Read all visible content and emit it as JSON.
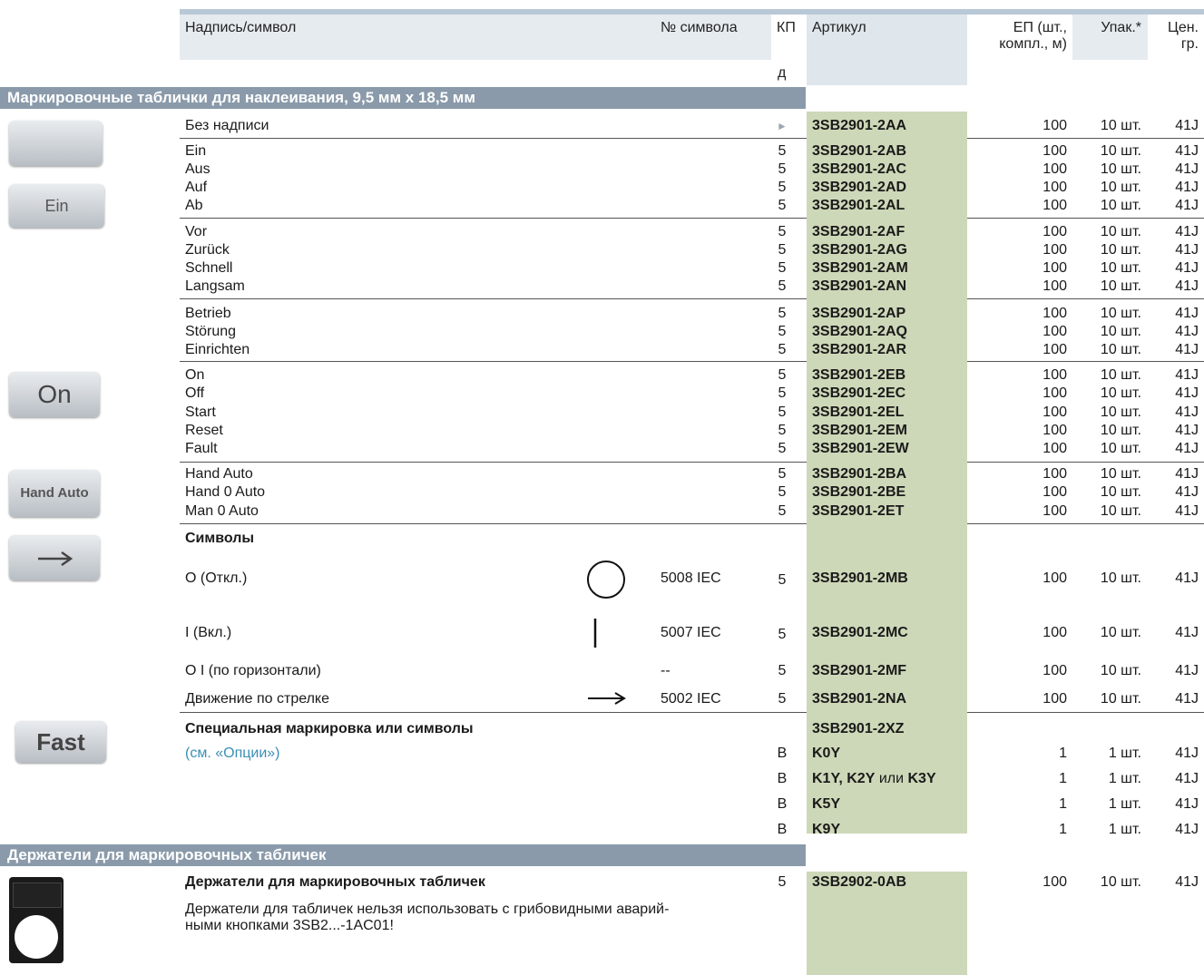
{
  "header": {
    "col_label": "Надпись/символ",
    "col_symbol": "№ символа",
    "col_kp": "КП",
    "col_kp2": "д",
    "col_article": "Артикул",
    "col_ep1": "ЕП (шт.,",
    "col_ep2": "компл., м)",
    "col_pack": "Упак.*",
    "col_price1": "Цен.",
    "col_price2": "гр."
  },
  "sections": {
    "labels_title": "Маркировочные таблички для наклеивания, 9,5 мм х 18,5 мм",
    "holders_title": "Держатели для маркировочных табличек"
  },
  "images": {
    "ein": "Ein",
    "on": "On",
    "hand_auto": "Hand Auto",
    "fast": "Fast"
  },
  "rows": [
    {
      "label": "Без надписи",
      "kp": "►",
      "art": "3SB2901-2AA",
      "ep": "100",
      "up": "10 шт.",
      "pr": "41J"
    },
    {
      "label": "Ein",
      "kp": "5",
      "art": "3SB2901-2AB",
      "ep": "100",
      "up": "10 шт.",
      "pr": "41J"
    },
    {
      "label": "Aus",
      "kp": "5",
      "art": "3SB2901-2AC",
      "ep": "100",
      "up": "10 шт.",
      "pr": "41J"
    },
    {
      "label": "Auf",
      "kp": "5",
      "art": "3SB2901-2AD",
      "ep": "100",
      "up": "10 шт.",
      "pr": "41J"
    },
    {
      "label": "Ab",
      "kp": "5",
      "art": "3SB2901-2AL",
      "ep": "100",
      "up": "10 шт.",
      "pr": "41J"
    },
    {
      "label": "Vor",
      "kp": "5",
      "art": "3SB2901-2AF",
      "ep": "100",
      "up": "10 шт.",
      "pr": "41J"
    },
    {
      "label": "Zurück",
      "kp": "5",
      "art": "3SB2901-2AG",
      "ep": "100",
      "up": "10 шт.",
      "pr": "41J"
    },
    {
      "label": "Schnell",
      "kp": "5",
      "art": "3SB2901-2AM",
      "ep": "100",
      "up": "10 шт.",
      "pr": "41J"
    },
    {
      "label": "Langsam",
      "kp": "5",
      "art": "3SB2901-2AN",
      "ep": "100",
      "up": "10 шт.",
      "pr": "41J"
    },
    {
      "label": "Betrieb",
      "kp": "5",
      "art": "3SB2901-2AP",
      "ep": "100",
      "up": "10 шт.",
      "pr": "41J"
    },
    {
      "label": "Störung",
      "kp": "5",
      "art": "3SB2901-2AQ",
      "ep": "100",
      "up": "10 шт.",
      "pr": "41J"
    },
    {
      "label": "Einrichten",
      "kp": "5",
      "art": "3SB2901-2AR",
      "ep": "100",
      "up": "10 шт.",
      "pr": "41J"
    },
    {
      "label": "On",
      "kp": "5",
      "art": "3SB2901-2EB",
      "ep": "100",
      "up": "10 шт.",
      "pr": "41J"
    },
    {
      "label": "Off",
      "kp": "5",
      "art": "3SB2901-2EC",
      "ep": "100",
      "up": "10 шт.",
      "pr": "41J"
    },
    {
      "label": "Start",
      "kp": "5",
      "art": "3SB2901-2EL",
      "ep": "100",
      "up": "10 шт.",
      "pr": "41J"
    },
    {
      "label": "Reset",
      "kp": "5",
      "art": "3SB2901-2EM",
      "ep": "100",
      "up": "10 шт.",
      "pr": "41J"
    },
    {
      "label": "Fault",
      "kp": "5",
      "art": "3SB2901-2EW",
      "ep": "100",
      "up": "10 шт.",
      "pr": "41J"
    },
    {
      "label": "Hand Auto",
      "kp": "5",
      "art": "3SB2901-2BA",
      "ep": "100",
      "up": "10 шт.",
      "pr": "41J"
    },
    {
      "label": "Hand 0 Auto",
      "kp": "5",
      "art": "3SB2901-2BE",
      "ep": "100",
      "up": "10 шт.",
      "pr": "41J"
    },
    {
      "label": "Man 0 Auto",
      "kp": "5",
      "art": "3SB2901-2ET",
      "ep": "100",
      "up": "10 шт.",
      "pr": "41J"
    }
  ],
  "symbols": {
    "title": "Символы",
    "items": [
      {
        "label": "O (Откл.)",
        "sym": "5008 IEC",
        "kp": "5",
        "art": "3SB2901-2MB",
        "ep": "100",
        "up": "10 шт.",
        "pr": "41J"
      },
      {
        "label": "I (Вкл.)",
        "sym": "5007 IEC",
        "kp": "5",
        "art": "3SB2901-2MC",
        "ep": "100",
        "up": "10 шт.",
        "pr": "41J"
      },
      {
        "label": "O  I (по горизонтали)",
        "sym": "--",
        "kp": "5",
        "art": "3SB2901-2MF",
        "ep": "100",
        "up": "10 шт.",
        "pr": "41J"
      },
      {
        "label": "Движение по стрелке",
        "sym": "5002 IEC",
        "kp": "5",
        "art": "3SB2901-2NA",
        "ep": "100",
        "up": "10 шт.",
        "pr": "41J"
      }
    ]
  },
  "special": {
    "title": "Специальная маркировка или символы",
    "title_art": "3SB2901-2XZ",
    "link": "(см. «Опции»)",
    "items": [
      {
        "kp": "B",
        "art": "K0Y",
        "ep": "1",
        "up": "1 шт.",
        "pr": "41J"
      },
      {
        "kp": "B",
        "art_a": "K1Y, K2Y",
        "art_or": " или ",
        "art_b": "K3Y",
        "ep": "1",
        "up": "1 шт.",
        "pr": "41J"
      },
      {
        "kp": "B",
        "art": "K5Y",
        "ep": "1",
        "up": "1 шт.",
        "pr": "41J"
      },
      {
        "kp": "B",
        "art": "K9Y",
        "ep": "1",
        "up": "1 шт.",
        "pr": "41J"
      }
    ]
  },
  "holders": {
    "title": "Держатели для маркировочных табличек",
    "kp": "5",
    "art": "3SB2902-0AB",
    "ep": "100",
    "up": "10 шт.",
    "pr": "41J",
    "note1": "Держатели для табличек нельзя использовать с грибовидными аварий-",
    "note2": "ными кнопками 3SB2...-1AC01!"
  }
}
